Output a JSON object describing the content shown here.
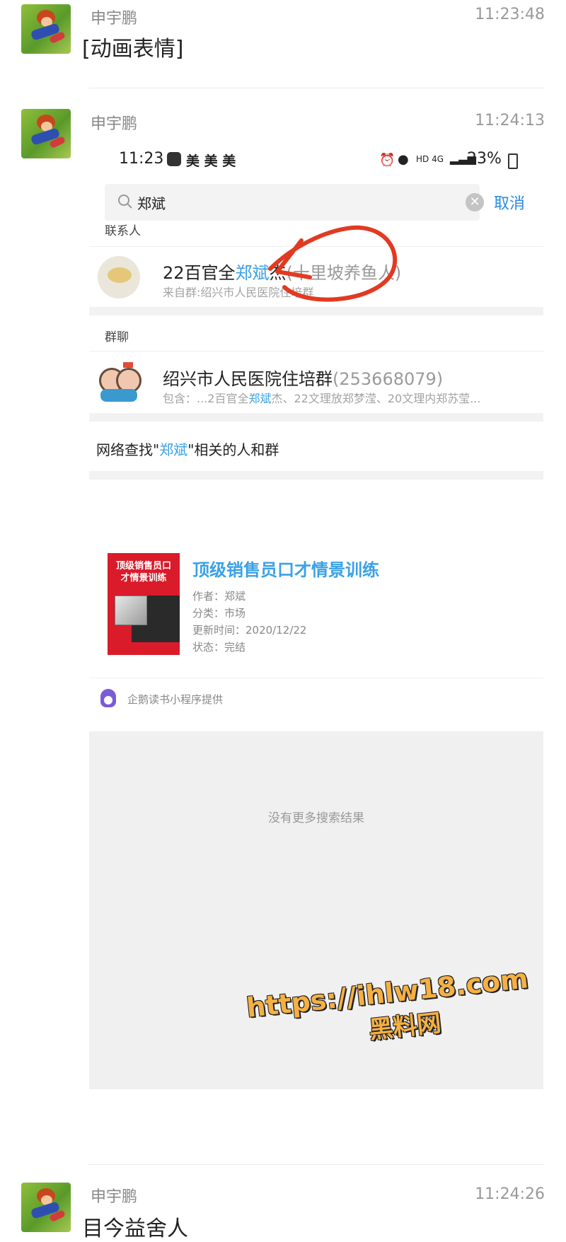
{
  "messages": [
    {
      "sender": "申宇鹏",
      "time": "11:23:48",
      "text": "[动画表情]"
    },
    {
      "sender": "申宇鹏",
      "time": "11:24:13"
    },
    {
      "sender": "申宇鹏",
      "time": "11:24:26",
      "text": "目今益舍人"
    }
  ],
  "shot": {
    "status": {
      "time": "11:23",
      "carriers": "美 美 美",
      "indicators": "HD 4G",
      "battery": "23%"
    },
    "search": {
      "query": "郑斌",
      "cancel": "取消"
    },
    "contacts_header": "联系人",
    "contact": {
      "prefix": "22百官全",
      "match": "郑斌",
      "suffix": "杰",
      "nickname": "(十里坡养鱼人)",
      "source": "来自群:绍兴市人民医院住培群"
    },
    "groups_header": "群聊",
    "group": {
      "name": "绍兴市人民医院住培群",
      "id": "(253668079)",
      "members_prefix": "包含：...2百官全",
      "members_match": "郑斌",
      "members_suffix": "杰、22文理放郑梦滢、20文理内郑苏莹..."
    },
    "network": {
      "before": "网络查找\"",
      "match": "郑斌",
      "after": "\"相关的人和群"
    },
    "book": {
      "cover_text": "顶级销售员口才情景训练",
      "title": "顶级销售员口才情景训练",
      "author": "作者：郑斌",
      "category": "分类：市场",
      "updated": "更新时间：2020/12/22",
      "status": "状态：完结"
    },
    "provider": "企鹅读书小程序提供",
    "no_more": "没有更多搜索结果"
  },
  "watermark": {
    "line1": "https://ihlw18.com",
    "line2": "黑料网"
  },
  "colors": {
    "highlight": "#3aa1e6",
    "annotation": "#e23a22",
    "watermark": "#f5b043"
  }
}
